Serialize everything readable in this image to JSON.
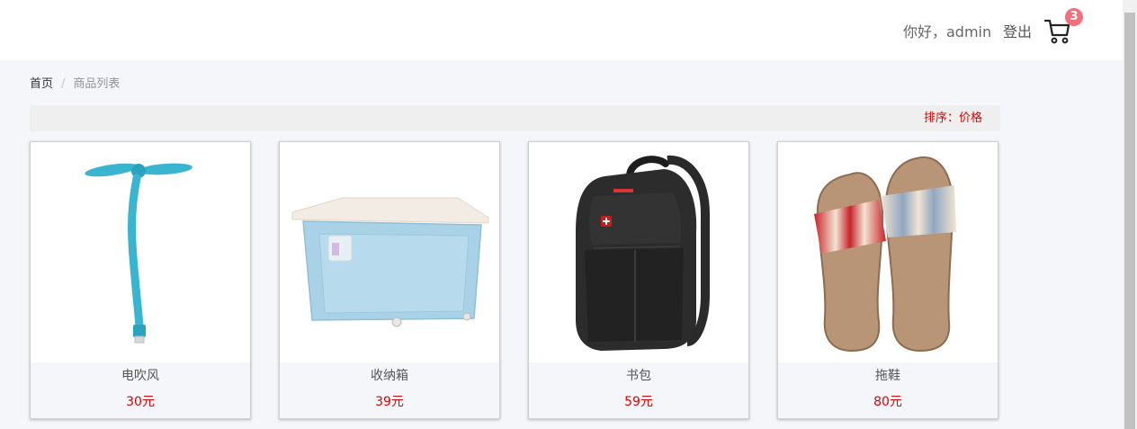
{
  "header": {
    "greeting": "你好，admin",
    "logout": "登出",
    "cart_count": "3",
    "cart_icon": "shopping-cart-icon"
  },
  "breadcrumb": {
    "home": "首页",
    "separator": "/",
    "current": "商品列表"
  },
  "sort": {
    "label": "排序：价格"
  },
  "products": [
    {
      "name": "电吹风",
      "price": "30元",
      "image": "usb-fan-image"
    },
    {
      "name": "收纳箱",
      "price": "39元",
      "image": "storage-box-image"
    },
    {
      "name": "书包",
      "price": "59元",
      "image": "backpack-image"
    },
    {
      "name": "拖鞋",
      "price": "80元",
      "image": "slippers-image"
    }
  ],
  "colors": {
    "accent_red": "#e00000",
    "badge": "#f0707e",
    "page_bg": "#f4f6fa"
  }
}
